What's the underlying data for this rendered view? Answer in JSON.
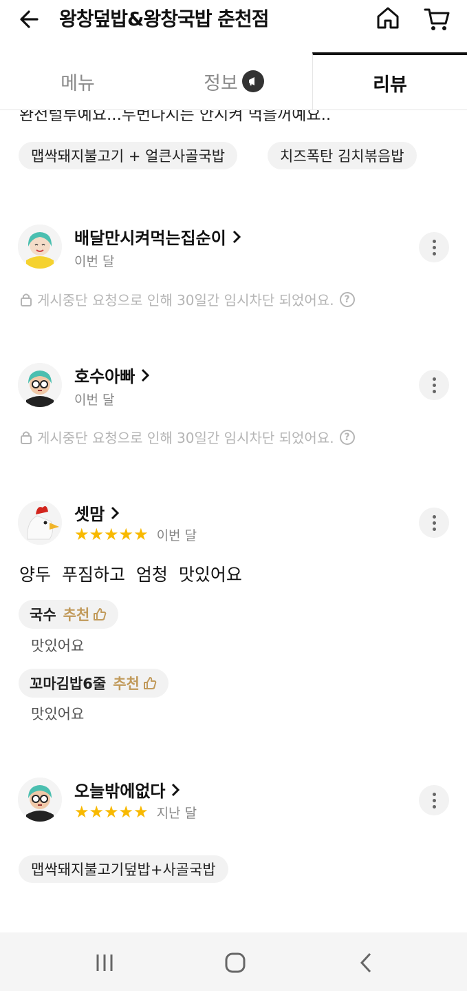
{
  "header": {
    "title": "왕창덮밥&왕창국밥 춘천점",
    "back_icon": "arrow-left-icon",
    "home_icon": "home-icon",
    "cart_icon": "cart-icon"
  },
  "tabs": [
    {
      "label": "메뉴",
      "active": false
    },
    {
      "label": "정보",
      "active": false
    },
    {
      "label": "리뷰",
      "active": true
    }
  ],
  "prev_review": {
    "cut_text": "완전털루예요...두번나시는 안시켜 먹을꺼예요..",
    "chips": [
      "맵싹돼지불고기 + 얼큰사골국밥",
      "치즈폭탄 김치볶음밥"
    ]
  },
  "reviews": [
    {
      "name": "배달만시켜먹는집순이",
      "date": "이번 달",
      "blocked_text": "게시중단 요청으로 인해 30일간 임시차단 되었어요.",
      "help_glyph": "?"
    },
    {
      "name": "호수아빠",
      "date": "이번 달",
      "blocked_text": "게시중단 요청으로 인해 30일간 임시차단 되었어요.",
      "help_glyph": "?"
    },
    {
      "name": "셋맘",
      "stars": "★★★★★",
      "rating": 5,
      "date": "이번 달",
      "text": "양두 푸짐하고 엄청 맛있어요",
      "recommendations": [
        {
          "item": "국수",
          "label": "추천",
          "comment": "맛있어요"
        },
        {
          "item": "꼬마김밥6줄",
          "label": "추천",
          "comment": "맛있어요"
        }
      ]
    },
    {
      "name": "오늘밖에없다",
      "stars": "★★★★★",
      "rating": 5,
      "date": "지난 달",
      "chips": [
        "맵싹돼지불고기덮밥+사골국밥"
      ]
    }
  ],
  "colors": {
    "star": "#f8b900",
    "recommend": "#c19a5b",
    "chip_bg": "#f2f2f2",
    "blocked_text": "#b5b5b5"
  }
}
